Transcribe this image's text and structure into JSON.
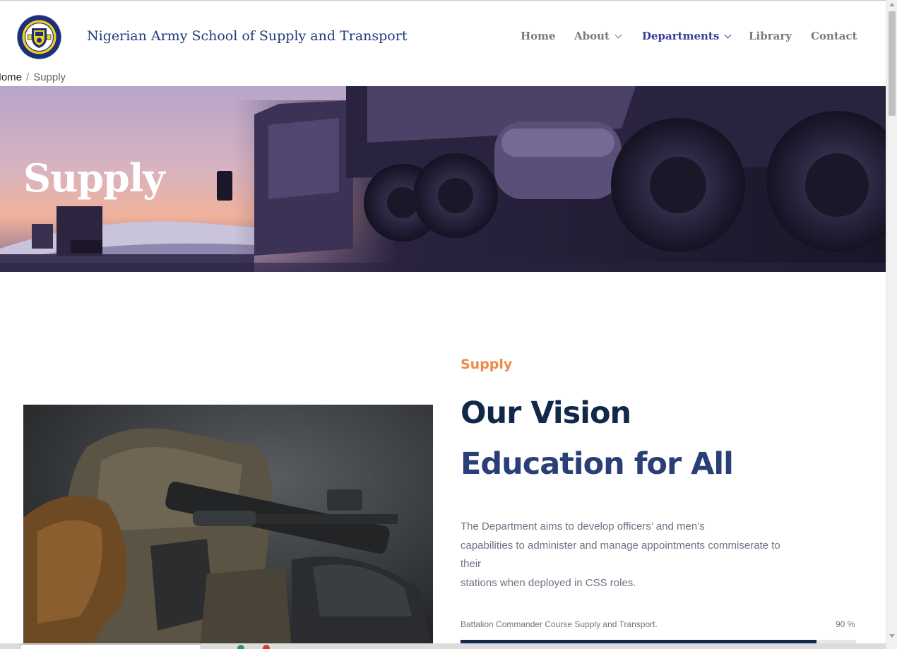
{
  "header": {
    "site_title": "Nigerian Army School of Supply and Transport",
    "logo_icon": "army-school-crest-icon"
  },
  "nav": {
    "items": [
      {
        "label": "Home",
        "has_dropdown": false,
        "active": false
      },
      {
        "label": "About",
        "has_dropdown": true,
        "active": false
      },
      {
        "label": "Departments",
        "has_dropdown": true,
        "active": true
      },
      {
        "label": "Library",
        "has_dropdown": false,
        "active": false
      },
      {
        "label": "Contact",
        "has_dropdown": false,
        "active": false
      }
    ]
  },
  "breadcrumb": {
    "home": "Home",
    "separator": "/",
    "current": "Supply"
  },
  "hero": {
    "title": "Supply"
  },
  "content": {
    "eyebrow": "Supply",
    "heading_line1": "Our Vision",
    "heading_line2": "Education for All",
    "description_lines": [
      "The Department aims to develop officers’ and men’s",
      "capabilities to administer and manage appointments commiserate to",
      "their",
      "stations when deployed in CSS roles."
    ]
  },
  "skill": {
    "label": "Battalion Commander Course Supply and Transport.",
    "percent_text": "90",
    "percent_sign": "%",
    "value": 0.9
  },
  "colors": {
    "title_blue": "#1f3a7a",
    "nav_active": "#3b3b9e",
    "nav_default": "#7a7a7a",
    "eyebrow_orange": "#ee8a4a",
    "heading_dark": "#12284a",
    "heading_blue": "#2a3f78",
    "body_text": "#6b7383"
  }
}
